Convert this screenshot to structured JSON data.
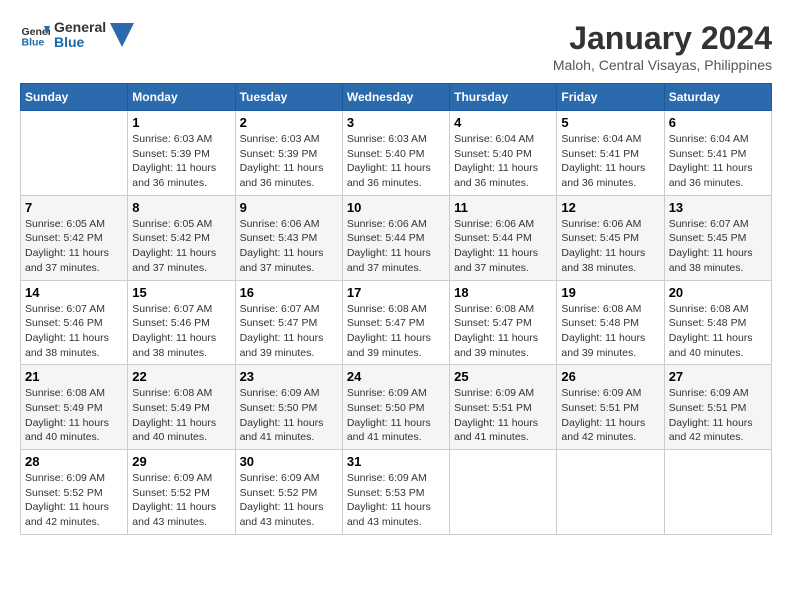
{
  "header": {
    "logo": {
      "line1": "General",
      "line2": "Blue"
    },
    "title": "January 2024",
    "location": "Maloh, Central Visayas, Philippines"
  },
  "days_of_week": [
    "Sunday",
    "Monday",
    "Tuesday",
    "Wednesday",
    "Thursday",
    "Friday",
    "Saturday"
  ],
  "weeks": [
    [
      {
        "day": "",
        "sunrise": "",
        "sunset": "",
        "daylight": ""
      },
      {
        "day": "1",
        "sunrise": "6:03 AM",
        "sunset": "5:39 PM",
        "daylight": "11 hours and 36 minutes."
      },
      {
        "day": "2",
        "sunrise": "6:03 AM",
        "sunset": "5:39 PM",
        "daylight": "11 hours and 36 minutes."
      },
      {
        "day": "3",
        "sunrise": "6:03 AM",
        "sunset": "5:40 PM",
        "daylight": "11 hours and 36 minutes."
      },
      {
        "day": "4",
        "sunrise": "6:04 AM",
        "sunset": "5:40 PM",
        "daylight": "11 hours and 36 minutes."
      },
      {
        "day": "5",
        "sunrise": "6:04 AM",
        "sunset": "5:41 PM",
        "daylight": "11 hours and 36 minutes."
      },
      {
        "day": "6",
        "sunrise": "6:04 AM",
        "sunset": "5:41 PM",
        "daylight": "11 hours and 36 minutes."
      }
    ],
    [
      {
        "day": "7",
        "sunrise": "6:05 AM",
        "sunset": "5:42 PM",
        "daylight": "11 hours and 37 minutes."
      },
      {
        "day": "8",
        "sunrise": "6:05 AM",
        "sunset": "5:42 PM",
        "daylight": "11 hours and 37 minutes."
      },
      {
        "day": "9",
        "sunrise": "6:06 AM",
        "sunset": "5:43 PM",
        "daylight": "11 hours and 37 minutes."
      },
      {
        "day": "10",
        "sunrise": "6:06 AM",
        "sunset": "5:44 PM",
        "daylight": "11 hours and 37 minutes."
      },
      {
        "day": "11",
        "sunrise": "6:06 AM",
        "sunset": "5:44 PM",
        "daylight": "11 hours and 37 minutes."
      },
      {
        "day": "12",
        "sunrise": "6:06 AM",
        "sunset": "5:45 PM",
        "daylight": "11 hours and 38 minutes."
      },
      {
        "day": "13",
        "sunrise": "6:07 AM",
        "sunset": "5:45 PM",
        "daylight": "11 hours and 38 minutes."
      }
    ],
    [
      {
        "day": "14",
        "sunrise": "6:07 AM",
        "sunset": "5:46 PM",
        "daylight": "11 hours and 38 minutes."
      },
      {
        "day": "15",
        "sunrise": "6:07 AM",
        "sunset": "5:46 PM",
        "daylight": "11 hours and 38 minutes."
      },
      {
        "day": "16",
        "sunrise": "6:07 AM",
        "sunset": "5:47 PM",
        "daylight": "11 hours and 39 minutes."
      },
      {
        "day": "17",
        "sunrise": "6:08 AM",
        "sunset": "5:47 PM",
        "daylight": "11 hours and 39 minutes."
      },
      {
        "day": "18",
        "sunrise": "6:08 AM",
        "sunset": "5:47 PM",
        "daylight": "11 hours and 39 minutes."
      },
      {
        "day": "19",
        "sunrise": "6:08 AM",
        "sunset": "5:48 PM",
        "daylight": "11 hours and 39 minutes."
      },
      {
        "day": "20",
        "sunrise": "6:08 AM",
        "sunset": "5:48 PM",
        "daylight": "11 hours and 40 minutes."
      }
    ],
    [
      {
        "day": "21",
        "sunrise": "6:08 AM",
        "sunset": "5:49 PM",
        "daylight": "11 hours and 40 minutes."
      },
      {
        "day": "22",
        "sunrise": "6:08 AM",
        "sunset": "5:49 PM",
        "daylight": "11 hours and 40 minutes."
      },
      {
        "day": "23",
        "sunrise": "6:09 AM",
        "sunset": "5:50 PM",
        "daylight": "11 hours and 41 minutes."
      },
      {
        "day": "24",
        "sunrise": "6:09 AM",
        "sunset": "5:50 PM",
        "daylight": "11 hours and 41 minutes."
      },
      {
        "day": "25",
        "sunrise": "6:09 AM",
        "sunset": "5:51 PM",
        "daylight": "11 hours and 41 minutes."
      },
      {
        "day": "26",
        "sunrise": "6:09 AM",
        "sunset": "5:51 PM",
        "daylight": "11 hours and 42 minutes."
      },
      {
        "day": "27",
        "sunrise": "6:09 AM",
        "sunset": "5:51 PM",
        "daylight": "11 hours and 42 minutes."
      }
    ],
    [
      {
        "day": "28",
        "sunrise": "6:09 AM",
        "sunset": "5:52 PM",
        "daylight": "11 hours and 42 minutes."
      },
      {
        "day": "29",
        "sunrise": "6:09 AM",
        "sunset": "5:52 PM",
        "daylight": "11 hours and 43 minutes."
      },
      {
        "day": "30",
        "sunrise": "6:09 AM",
        "sunset": "5:52 PM",
        "daylight": "11 hours and 43 minutes."
      },
      {
        "day": "31",
        "sunrise": "6:09 AM",
        "sunset": "5:53 PM",
        "daylight": "11 hours and 43 minutes."
      },
      {
        "day": "",
        "sunrise": "",
        "sunset": "",
        "daylight": ""
      },
      {
        "day": "",
        "sunrise": "",
        "sunset": "",
        "daylight": ""
      },
      {
        "day": "",
        "sunrise": "",
        "sunset": "",
        "daylight": ""
      }
    ]
  ]
}
